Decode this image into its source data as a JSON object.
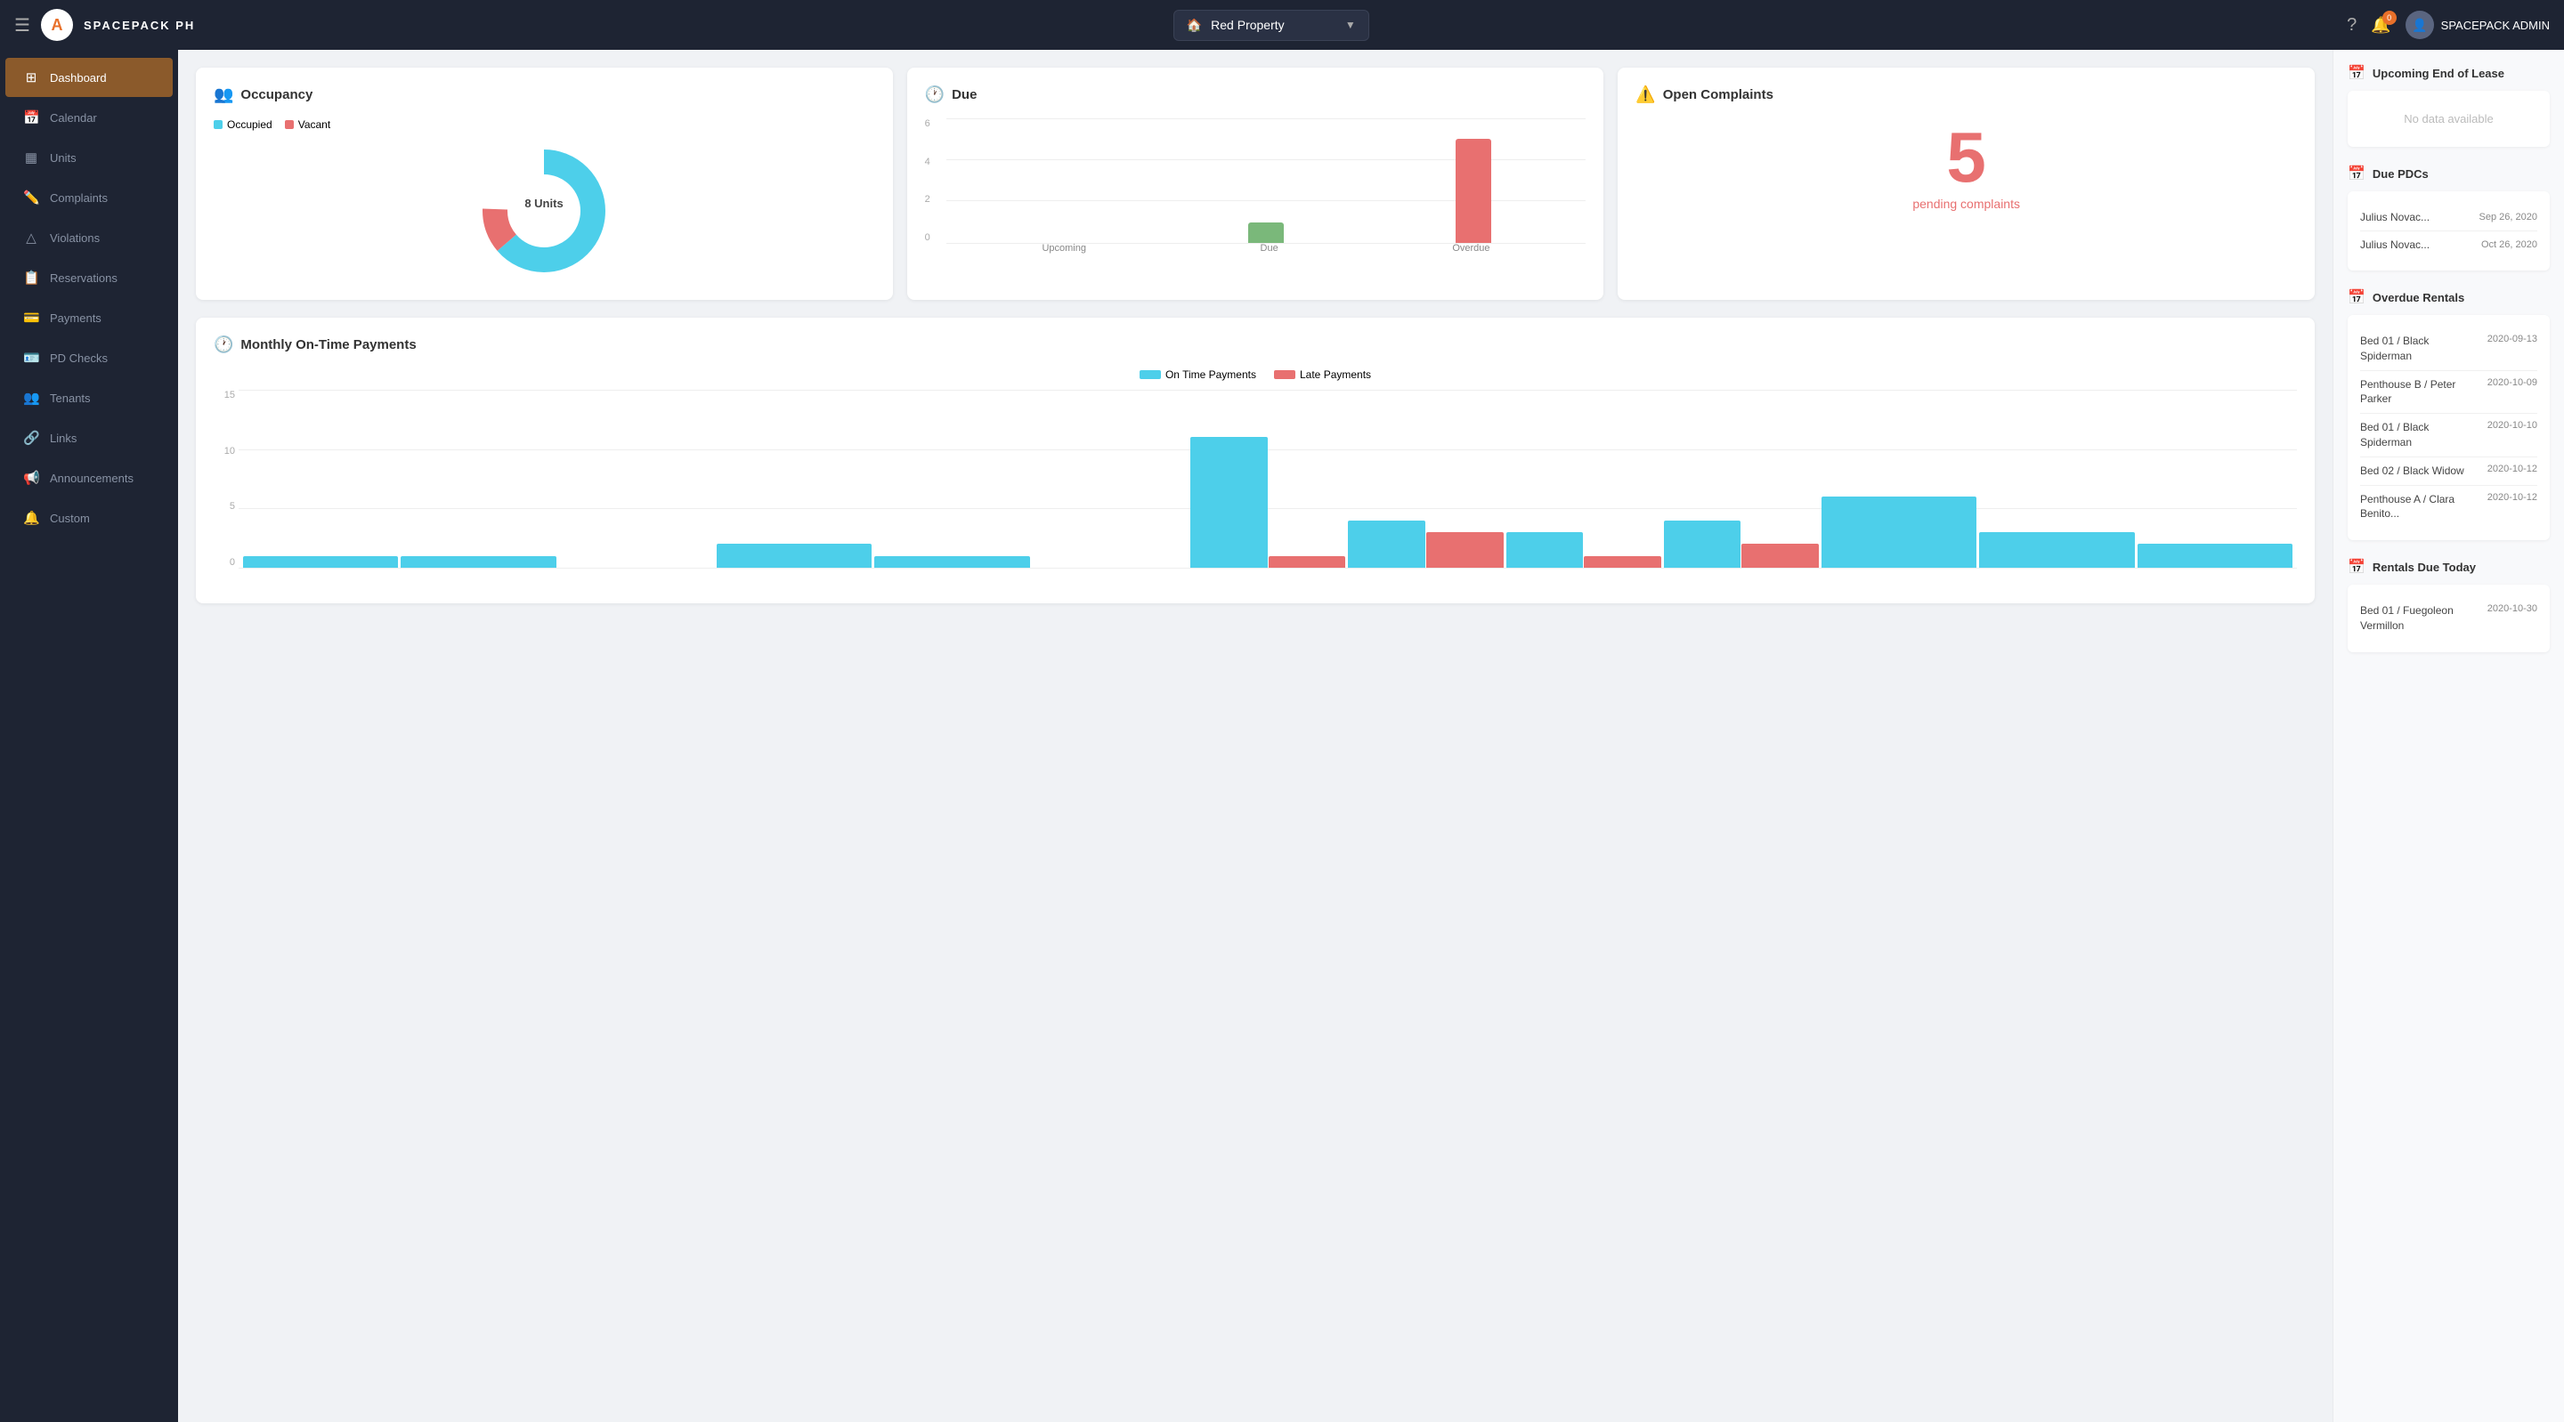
{
  "app": {
    "title": "SPACEPACK PH",
    "logo_letter": "A"
  },
  "topnav": {
    "property": "Red Property",
    "admin_name": "SPACEPACK ADMIN",
    "notification_count": "0"
  },
  "sidebar": {
    "items": [
      {
        "id": "dashboard",
        "label": "Dashboard",
        "icon": "⊞",
        "active": true
      },
      {
        "id": "calendar",
        "label": "Calendar",
        "icon": "📅"
      },
      {
        "id": "units",
        "label": "Units",
        "icon": "▦"
      },
      {
        "id": "complaints",
        "label": "Complaints",
        "icon": "✏️"
      },
      {
        "id": "violations",
        "label": "Violations",
        "icon": "△"
      },
      {
        "id": "reservations",
        "label": "Reservations",
        "icon": "📋"
      },
      {
        "id": "payments",
        "label": "Payments",
        "icon": "💳"
      },
      {
        "id": "pd-checks",
        "label": "PD Checks",
        "icon": "🪪"
      },
      {
        "id": "tenants",
        "label": "Tenants",
        "icon": "👥"
      },
      {
        "id": "links",
        "label": "Links",
        "icon": "🔗"
      },
      {
        "id": "announcements",
        "label": "Announcements",
        "icon": "📢"
      },
      {
        "id": "custom",
        "label": "Custom",
        "icon": "🔔"
      }
    ]
  },
  "occupancy": {
    "title": "Occupancy",
    "total_units": "8 Units",
    "legend": [
      {
        "label": "Occupied",
        "color": "#4dcfea"
      },
      {
        "label": "Vacant",
        "color": "#e87070"
      }
    ],
    "occupied_pct": 88,
    "vacant_pct": 12
  },
  "due": {
    "title": "Due",
    "bars": [
      {
        "label": "Upcoming",
        "value": 0,
        "color": "#4dcfea"
      },
      {
        "label": "Due",
        "value": 1,
        "color": "#7ab87a"
      },
      {
        "label": "Overdue",
        "value": 5,
        "color": "#e87070"
      }
    ],
    "max_y": 6,
    "y_labels": [
      "6",
      "4",
      "2",
      "0"
    ]
  },
  "complaints": {
    "title": "Open Complaints",
    "count": "5",
    "subtitle": "pending complaints"
  },
  "payments": {
    "title": "Monthly On-Time Payments",
    "legend": [
      {
        "label": "On Time Payments",
        "color": "#4dcfea"
      },
      {
        "label": "Late Payments",
        "color": "#e87070"
      }
    ],
    "y_labels": [
      "15",
      "10",
      "5",
      "0"
    ],
    "bars": [
      {
        "ontime": 1,
        "late": 0
      },
      {
        "ontime": 1,
        "late": 0
      },
      {
        "ontime": 0,
        "late": 0
      },
      {
        "ontime": 2,
        "late": 0
      },
      {
        "ontime": 1,
        "late": 0
      },
      {
        "ontime": 0,
        "late": 0
      },
      {
        "ontime": 11,
        "late": 1
      },
      {
        "ontime": 4,
        "late": 3
      },
      {
        "ontime": 3,
        "late": 1
      },
      {
        "ontime": 4,
        "late": 2
      },
      {
        "ontime": 6,
        "late": 0
      },
      {
        "ontime": 3,
        "late": 0
      },
      {
        "ontime": 2,
        "late": 0
      }
    ],
    "max_value": 15
  },
  "right_panel": {
    "upcoming_lease": {
      "title": "Upcoming End of Lease",
      "no_data": "No data available"
    },
    "due_pdcs": {
      "title": "Due PDCs",
      "items": [
        {
          "name": "Julius Novac...",
          "date": "Sep 26, 2020"
        },
        {
          "name": "Julius Novac...",
          "date": "Oct 26, 2020"
        }
      ]
    },
    "overdue_rentals": {
      "title": "Overdue Rentals",
      "items": [
        {
          "name": "Bed 01 / Black Spiderman",
          "date": "2020-09-13"
        },
        {
          "name": "Penthouse B / Peter Parker",
          "date": "2020-10-09"
        },
        {
          "name": "Bed 01 / Black Spiderman",
          "date": "2020-10-10"
        },
        {
          "name": "Bed 02 / Black Widow",
          "date": "2020-10-12"
        },
        {
          "name": "Penthouse A / Clara Benito...",
          "date": "2020-10-12"
        }
      ]
    },
    "rentals_due_today": {
      "title": "Rentals Due Today",
      "items": [
        {
          "name": "Bed 01 / Fuegoleon Vermillon",
          "date": "2020-10-30"
        }
      ]
    }
  }
}
